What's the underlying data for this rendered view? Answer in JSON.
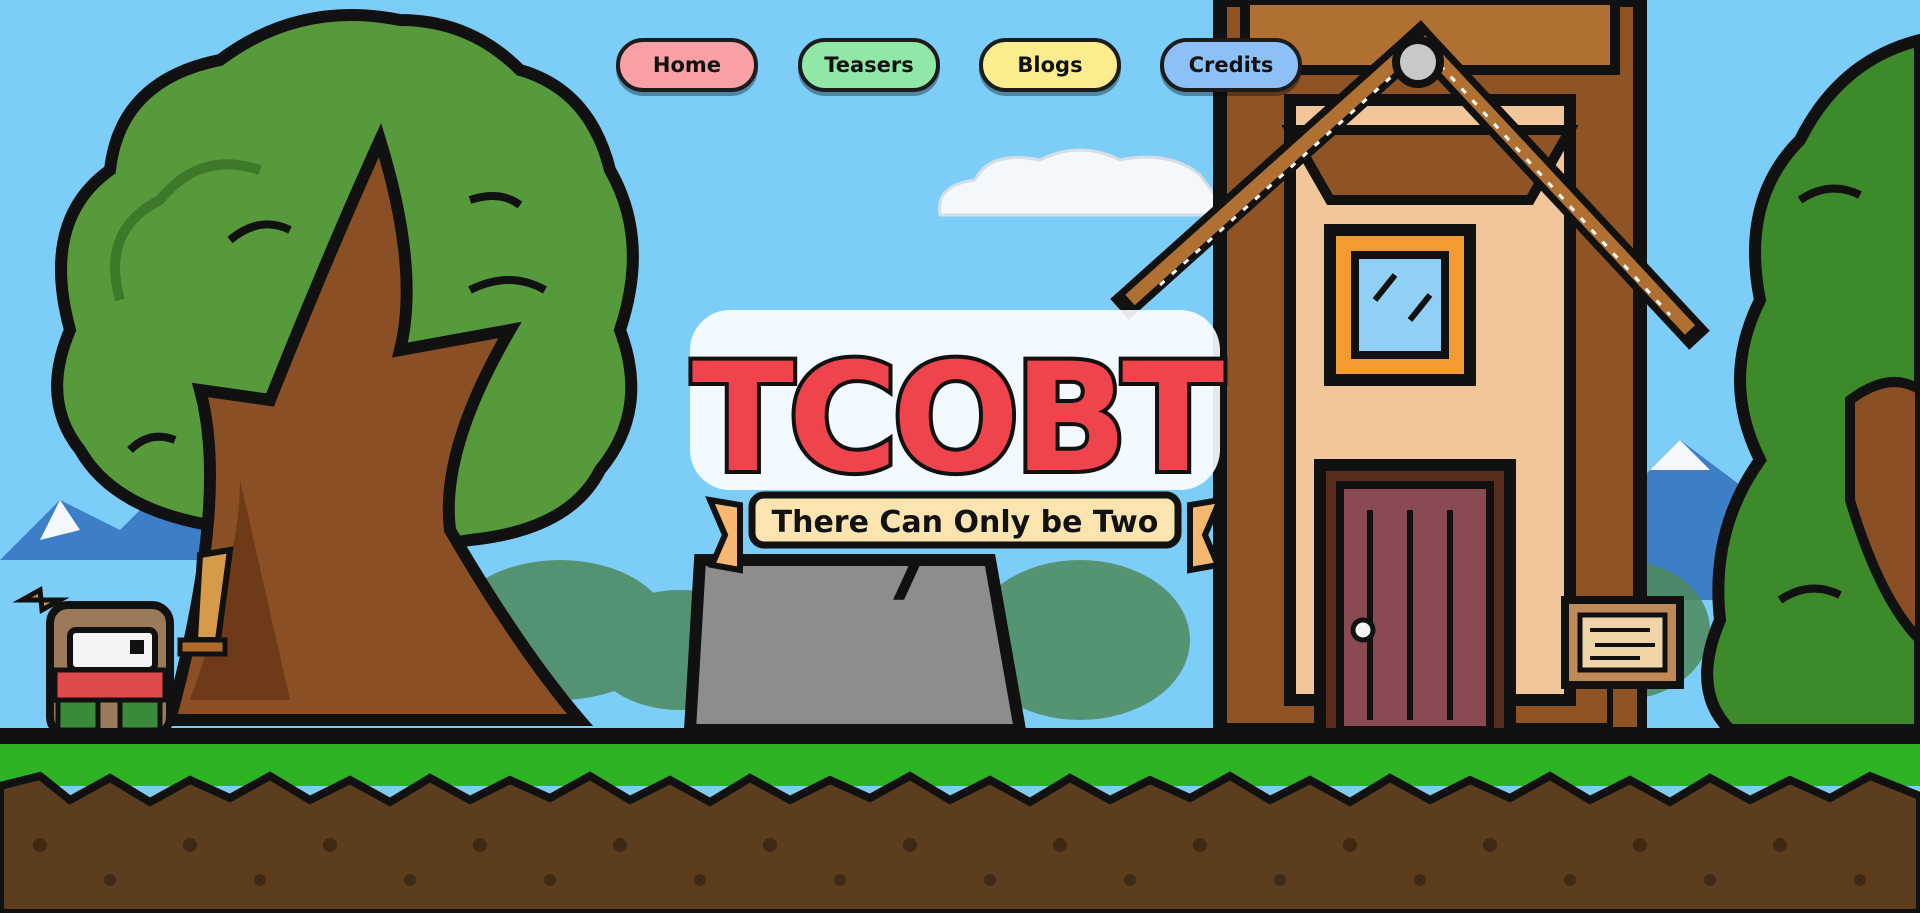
{
  "nav": {
    "items": [
      {
        "label": "Home",
        "color": "#f8a0a6"
      },
      {
        "label": "Teasers",
        "color": "#8fe8a6"
      },
      {
        "label": "Blogs",
        "color": "#fbec8e"
      },
      {
        "label": "Credits",
        "color": "#8ec0f8"
      }
    ]
  },
  "logo": {
    "title": "TCOBT",
    "tagline": "There Can Only be Two"
  },
  "tombstone": {
    "glyph": "7"
  },
  "colors": {
    "sky": "#7ccdf7",
    "grass": "#2db324",
    "dirt": "#5c3d1e",
    "logo_red": "#f0444c",
    "logo_pink": "#f07aa4",
    "banner": "#fbe4b0"
  }
}
